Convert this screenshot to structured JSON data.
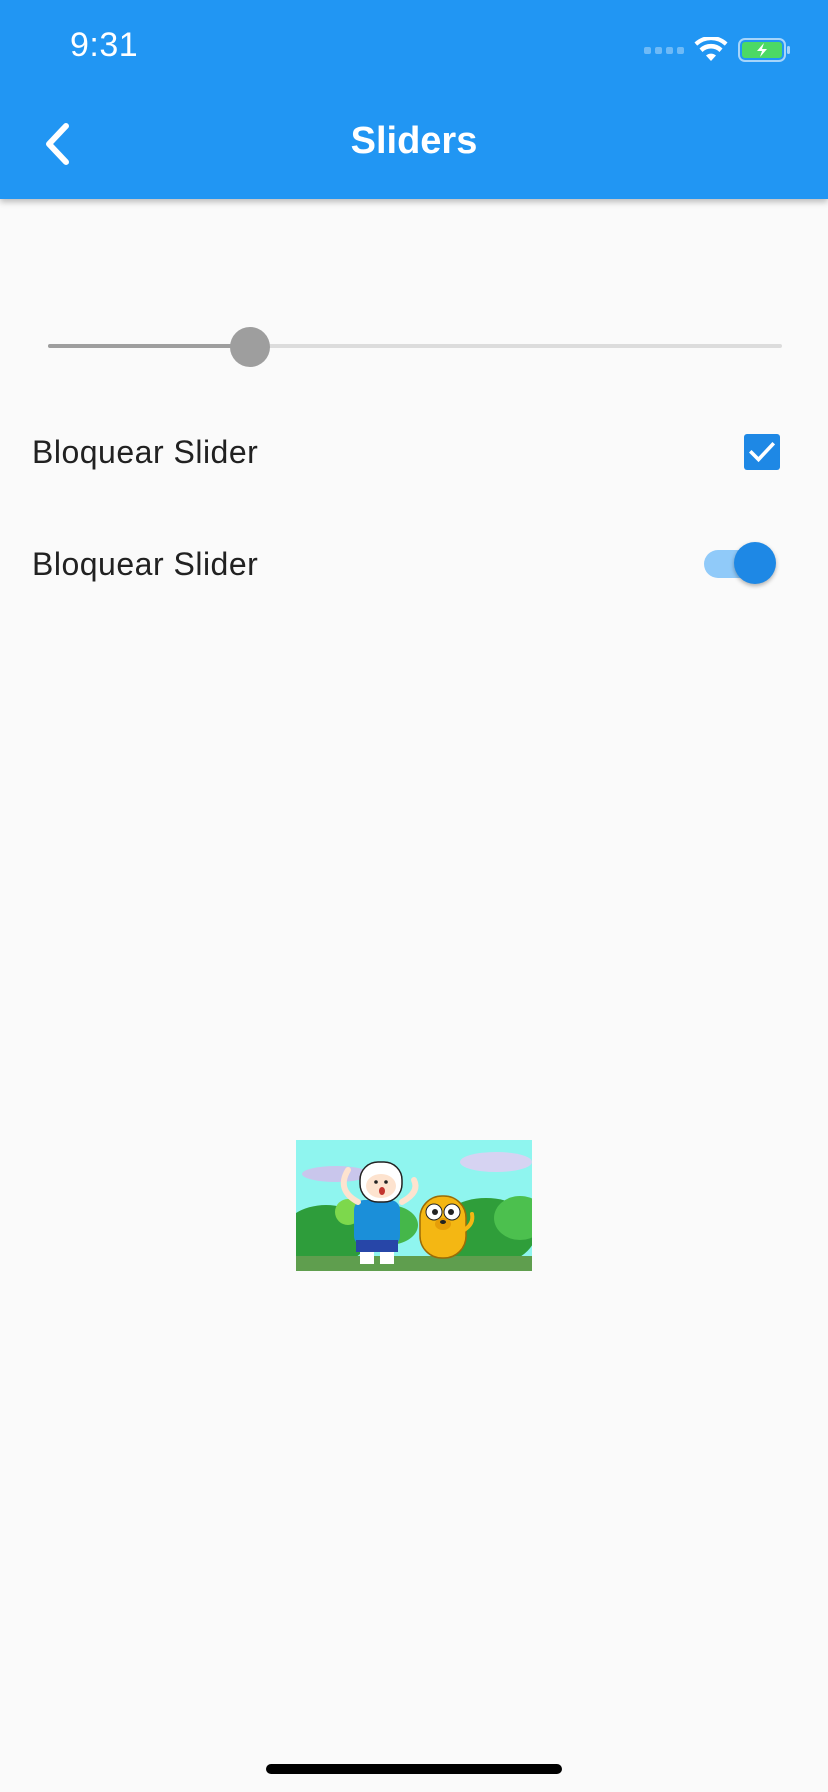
{
  "status_bar": {
    "time": "9:31",
    "icons": [
      "cellular-signal-icon",
      "wifi-icon",
      "battery-charging-icon"
    ]
  },
  "app_bar": {
    "title": "Sliders",
    "back_icon": "chevron-left-icon",
    "color": "#2196f3"
  },
  "slider": {
    "value_fraction": 0.275,
    "disabled": true,
    "active_color": "#9e9e9e",
    "inactive_color": "#dcdcdc"
  },
  "checkbox_row": {
    "label": "Bloquear Slider",
    "checked": true,
    "color": "#1e88e5"
  },
  "switch_row": {
    "label": "Bloquear Slider",
    "on": true,
    "color": "#1e88e5"
  },
  "image": {
    "subject": "cartoon-illustration"
  }
}
